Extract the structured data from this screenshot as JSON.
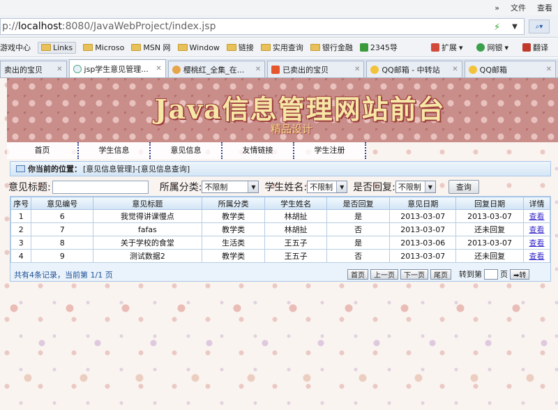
{
  "browser": {
    "menu": [
      "»",
      "文件",
      "查看"
    ],
    "url_prefix": "p://",
    "url_host": "localhost",
    "url_rest": ":8080/JavaWebProject/index.jsp",
    "favorites": [
      "游戏中心",
      "Links",
      "Microso",
      "MSN 网",
      "Window",
      "链接",
      "实用查询",
      "银行金融",
      "2345导"
    ],
    "toolbar_right": [
      "扩展",
      "网银",
      "翻译"
    ],
    "tabs": [
      {
        "label": "卖出的宝贝",
        "active": false
      },
      {
        "label": "jsp学生意见管理...",
        "active": true
      },
      {
        "label": "樱桃红_全集_在...",
        "active": false
      },
      {
        "label": "已卖出的宝贝",
        "active": false
      },
      {
        "label": "QQ邮箱 - 中转站",
        "active": false
      },
      {
        "label": "QQ邮箱",
        "active": false
      }
    ]
  },
  "site": {
    "title": "Java信息管理网站前台",
    "subtitle": "精品设计",
    "nav": [
      "首页",
      "学生信息",
      "意见信息",
      "友情链接",
      "学生注册"
    ]
  },
  "breadcrumb": {
    "label": "你当前的位置：",
    "path": "[意见信息管理]-[意见信息查询]"
  },
  "filter": {
    "title_label": "意见标题:",
    "title_value": "",
    "category_label": "所属分类:",
    "category_value": "不限制",
    "student_label": "学生姓名:",
    "student_value": "不限制",
    "reply_label": "是否回复:",
    "reply_value": "不限制",
    "query_button": "查询"
  },
  "table": {
    "headers": [
      "序号",
      "意见编号",
      "意见标题",
      "所属分类",
      "学生姓名",
      "是否回复",
      "意见日期",
      "回复日期",
      "详情"
    ],
    "rows": [
      [
        "1",
        "6",
        "我觉得讲课慢点",
        "教学类",
        "林胡扯",
        "是",
        "2013-03-07",
        "2013-03-07",
        "查看"
      ],
      [
        "2",
        "7",
        "fafas",
        "教学类",
        "林胡扯",
        "否",
        "2013-03-07",
        "还未回复",
        "查看"
      ],
      [
        "3",
        "8",
        "关于学校的食堂",
        "生活类",
        "王五子",
        "是",
        "2013-03-06",
        "2013-03-07",
        "查看"
      ],
      [
        "4",
        "9",
        "测试数据2",
        "教学类",
        "王五子",
        "否",
        "2013-03-07",
        "还未回复",
        "查看"
      ]
    ]
  },
  "pager": {
    "summary": "共有4条记录，当前第 1/1 页",
    "first": "首页",
    "prev": "上一页",
    "next": "下一页",
    "last": "尾页",
    "goto_label": "转到第",
    "page_unit": "页",
    "goto_button": "➡转"
  }
}
